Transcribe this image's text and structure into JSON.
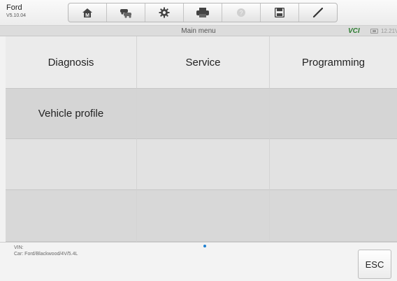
{
  "app": {
    "name": "Ford",
    "version": "V5.10.04"
  },
  "toolbar": {
    "buttons": [
      {
        "icon": "home-icon"
      },
      {
        "icon": "vehicle-swap-icon"
      },
      {
        "icon": "settings-gear-icon"
      },
      {
        "icon": "printer-icon"
      },
      {
        "icon": "help-icon",
        "disabled": true
      },
      {
        "icon": "save-icon"
      },
      {
        "icon": "pen-icon"
      }
    ]
  },
  "header": {
    "title": "Main menu",
    "vci": "VCI",
    "voltage": "12.21V"
  },
  "menu": {
    "items": [
      "Diagnosis",
      "Service",
      "Programming",
      "Vehicle profile"
    ]
  },
  "footer": {
    "vin": "VIN:",
    "car": "Car: Ford/Blackwood/4V/5.4L",
    "esc": "ESC"
  },
  "colors": {
    "accent": "#1e7fd1",
    "vci_green": "#2e7d32"
  }
}
